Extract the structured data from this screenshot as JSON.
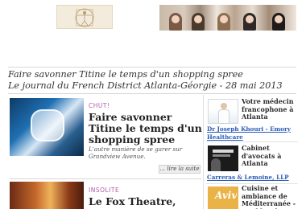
{
  "page": {
    "title": "Faire savonner Titine le temps d'un shopping spree",
    "subtitle": "Le journal du French District Atlanta-Géorgie - 28 mai 2013"
  },
  "articles": [
    {
      "kicker": "CHUT!",
      "title": "Faire savonner Titine le temps d'un shopping spree",
      "description": "L'autre manière de se garer sur Grandview Avenue.",
      "read_more": "... lire la suite"
    },
    {
      "kicker": "INSOLITE",
      "title": "Le Fox Theatre,"
    }
  ],
  "sidebar": {
    "items": [
      {
        "title": "Votre médecin francophone à Atlanta",
        "link": "Dr Joseph Khouri - Emory Healthcare"
      },
      {
        "title": "Cabinet d'avocats à Atlanta",
        "link": "Carreras & Lemoine, LLP"
      },
      {
        "title": "Cuisine et ambiance de Méditerranée - Buckhead",
        "badge": "Aviv"
      }
    ]
  },
  "colors": {
    "kicker": "#b05aa8",
    "link": "#2a5bb5",
    "text": "#2b2b2b"
  }
}
